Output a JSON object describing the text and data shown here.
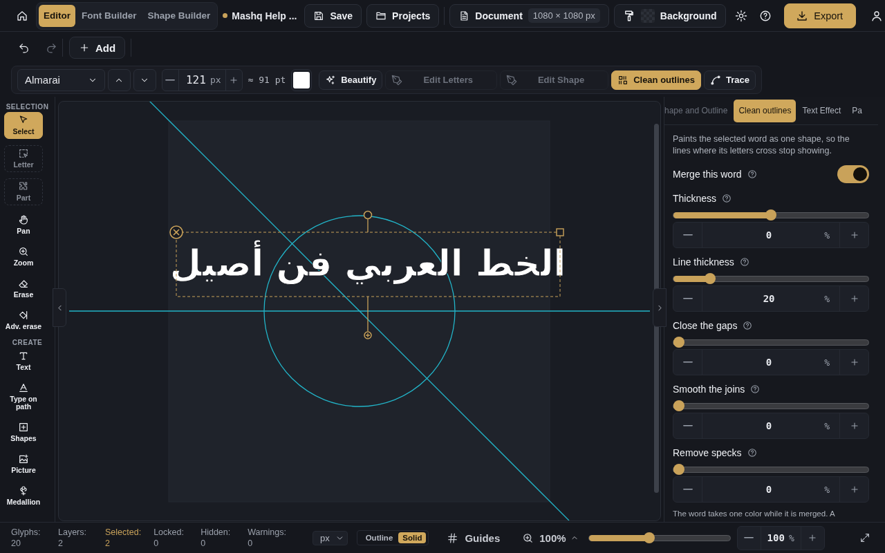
{
  "top_bar": {
    "modes": [
      {
        "label": "Editor",
        "selected": true
      },
      {
        "label": "Font Builder",
        "selected": false
      },
      {
        "label": "Shape Builder",
        "selected": false
      }
    ],
    "project": {
      "title": "Mashq Help ...",
      "unsaved": true
    },
    "actions": [
      {
        "kind": "save",
        "label": "Save"
      },
      {
        "kind": "projects",
        "label": "Projects"
      }
    ],
    "document": {
      "label": "Document",
      "size": "1080 × 1080 px"
    },
    "background": {
      "label": "Background"
    },
    "export": {
      "label": "Export"
    }
  },
  "edit_bar": {
    "history": [
      {
        "kind": "undo",
        "disabled": false
      },
      {
        "kind": "redo",
        "disabled": true
      }
    ],
    "add": "Add"
  },
  "text_toolbar": {
    "font": "Almarai",
    "size": "121",
    "size_unit": "px",
    "points": "≈ 91 pt",
    "tools": [
      {
        "label": "Beautify",
        "selected": false,
        "disabled": false
      },
      {
        "label": "Edit Letters",
        "selected": false,
        "disabled": true
      },
      {
        "label": "Edit Shape",
        "selected": false,
        "disabled": true
      },
      {
        "label": "Clean outlines",
        "selected": true,
        "disabled": false
      },
      {
        "label": "Trace",
        "selected": false,
        "disabled": false
      }
    ]
  },
  "sidebar": {
    "sections": [
      {
        "title": "SELECTION",
        "tools": [
          {
            "label": "Select",
            "selected": true,
            "disabled": false
          },
          {
            "label": "Letter",
            "selected": false,
            "disabled": true
          },
          {
            "label": "Part",
            "selected": false,
            "disabled": true
          },
          {
            "label": "Pan",
            "selected": false,
            "disabled": false
          },
          {
            "label": "Zoom",
            "selected": false,
            "disabled": false
          },
          {
            "label": "Erase",
            "selected": false,
            "disabled": false
          },
          {
            "label": "Adv. erase",
            "selected": false,
            "disabled": false
          }
        ]
      },
      {
        "title": "CREATE",
        "tools": [
          {
            "label": "Text",
            "selected": false,
            "disabled": false
          },
          {
            "label": "Type on path",
            "selected": false,
            "disabled": false
          },
          {
            "label": "Shapes",
            "selected": false,
            "disabled": false
          },
          {
            "label": "Picture",
            "selected": false,
            "disabled": false
          },
          {
            "label": "Medallion",
            "selected": false,
            "disabled": false
          }
        ]
      }
    ]
  },
  "canvas": {
    "text": "الخط العربي فن أصيل",
    "selected": true
  },
  "panel": {
    "tabs": [
      {
        "label": "hape and Outline",
        "selected": false
      },
      {
        "label": "Clean outlines",
        "selected": true
      },
      {
        "label": "Text Effect",
        "selected": false
      },
      {
        "label": "Pa",
        "selected": false
      }
    ],
    "description": "Paints the selected word as one shape, so the lines where its letters cross stop showing.",
    "merge": {
      "label": "Merge this word",
      "on": true
    },
    "settings": [
      {
        "label": "Thickness",
        "level": 0.5,
        "value": "0",
        "unit": "%"
      },
      {
        "label": "Line thickness",
        "level": 0.17,
        "value": "20",
        "unit": "%"
      },
      {
        "label": "Close the gaps",
        "level": 0,
        "value": "0",
        "unit": "%"
      },
      {
        "label": "Smooth the joins",
        "level": 0,
        "value": "0",
        "unit": "%"
      },
      {
        "label": "Remove specks",
        "level": 0,
        "value": "0",
        "unit": "%"
      }
    ],
    "note": "The word takes one color while it is merged. A"
  },
  "status_bar": {
    "counts": [
      {
        "label": "Glyphs:",
        "value": "20",
        "selected": false
      },
      {
        "label": "Layers:",
        "value": "2",
        "selected": false
      },
      {
        "label": "Selected:",
        "value": "2",
        "selected": true
      },
      {
        "label": "Locked:",
        "value": "0",
        "selected": false
      },
      {
        "label": "Hidden:",
        "value": "0",
        "selected": false
      },
      {
        "label": "Warnings:",
        "value": "0",
        "selected": false
      }
    ],
    "unit": "px",
    "view_modes": [
      {
        "label": "Outline",
        "selected": false
      },
      {
        "label": "Solid",
        "selected": true
      }
    ],
    "guides": "Guides",
    "zoom": {
      "label": "100%",
      "level": 0.42,
      "value": "100",
      "unit": "%"
    }
  }
}
